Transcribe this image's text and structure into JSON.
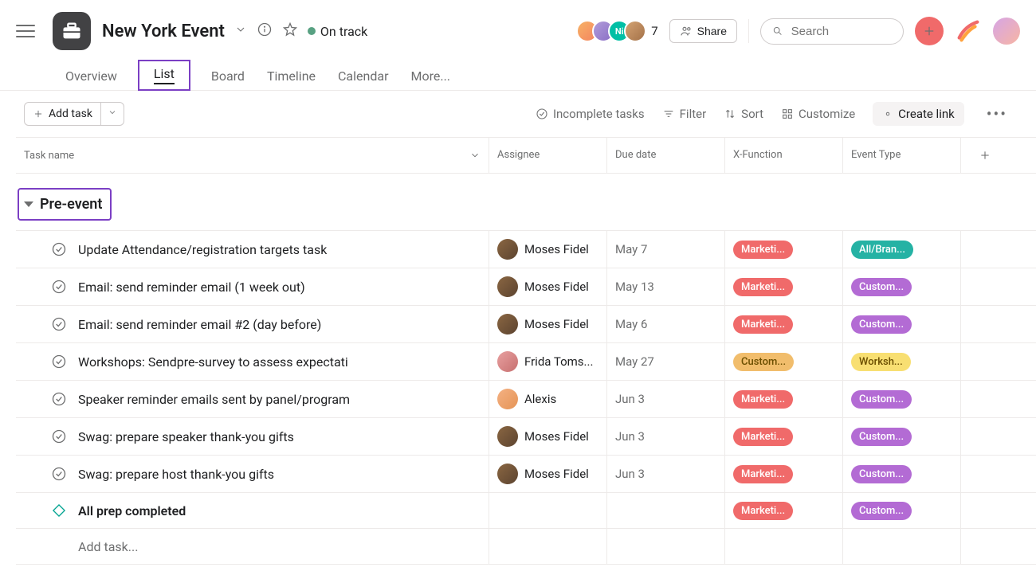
{
  "header": {
    "project_title": "New York Event",
    "status_label": "On track",
    "status_color": "#58a182",
    "member_initials": "Ni",
    "member_count": "7",
    "share_label": "Share",
    "search_placeholder": "Search"
  },
  "avatar_colors": [
    "linear-gradient(135deg,#f7b267,#f4845f)",
    "linear-gradient(135deg,#b19cd9,#8a6fc6)",
    "#00bfa5",
    "linear-gradient(135deg,#d4a373,#a47148)"
  ],
  "tabs": [
    {
      "label": "Overview"
    },
    {
      "label": "List",
      "active": true
    },
    {
      "label": "Board"
    },
    {
      "label": "Timeline"
    },
    {
      "label": "Calendar"
    },
    {
      "label": "More..."
    }
  ],
  "toolbar": {
    "add_task": "Add task",
    "incomplete": "Incomplete tasks",
    "filter": "Filter",
    "sort": "Sort",
    "customize": "Customize",
    "create_link": "Create link"
  },
  "columns": {
    "task": "Task name",
    "assignee": "Assignee",
    "due": "Due date",
    "xfn": "X-Function",
    "event": "Event Type"
  },
  "section": {
    "title": "Pre-event"
  },
  "pill_colors": {
    "marketing": "#f06a6a",
    "customer_yellow": "#f1bd6c",
    "all_brand": "#25b2a4",
    "customer_purple": "#b36bd4",
    "workshop": "#f8df72"
  },
  "tasks": [
    {
      "name": "Update Attendance/registration targets task",
      "assignee": {
        "name": "Moses Fidel",
        "color": "linear-gradient(135deg,#8a6642,#5c4430)"
      },
      "due": "May 7",
      "xfn": {
        "text": "Marketi...",
        "ckey": "marketing"
      },
      "event": {
        "text": "All/Bran...",
        "ckey": "all_brand"
      }
    },
    {
      "name": "Email: send reminder email (1 week out)",
      "assignee": {
        "name": "Moses Fidel",
        "color": "linear-gradient(135deg,#8a6642,#5c4430)"
      },
      "due": "May 13",
      "xfn": {
        "text": "Marketi...",
        "ckey": "marketing"
      },
      "event": {
        "text": "Custom...",
        "ckey": "customer_purple"
      }
    },
    {
      "name": "Email: send reminder email #2 (day before)",
      "assignee": {
        "name": "Moses Fidel",
        "color": "linear-gradient(135deg,#8a6642,#5c4430)"
      },
      "due": "May 6",
      "xfn": {
        "text": "Marketi...",
        "ckey": "marketing"
      },
      "event": {
        "text": "Custom...",
        "ckey": "customer_purple"
      }
    },
    {
      "name": "Workshops: Sendpre-survey to assess expectati",
      "assignee": {
        "name": "Frida Toms...",
        "color": "linear-gradient(135deg,#e8a0a0,#c77070)"
      },
      "due": "May 27",
      "xfn": {
        "text": "Custom...",
        "ckey": "customer_yellow"
      },
      "event": {
        "text": "Worksh...",
        "ckey": "workshop",
        "dark": true
      }
    },
    {
      "name": "Speaker reminder emails sent by panel/program",
      "assignee": {
        "name": "Alexis",
        "color": "linear-gradient(135deg,#f4b183,#e59456)"
      },
      "due": "Jun 3",
      "xfn": {
        "text": "Marketi...",
        "ckey": "marketing"
      },
      "event": {
        "text": "Custom...",
        "ckey": "customer_purple"
      }
    },
    {
      "name": "Swag: prepare speaker thank-you gifts",
      "assignee": {
        "name": "Moses Fidel",
        "color": "linear-gradient(135deg,#8a6642,#5c4430)"
      },
      "due": "Jun 3",
      "xfn": {
        "text": "Marketi...",
        "ckey": "marketing"
      },
      "event": {
        "text": "Custom...",
        "ckey": "customer_purple"
      }
    },
    {
      "name": "Swag: prepare host thank-you gifts",
      "assignee": {
        "name": "Moses Fidel",
        "color": "linear-gradient(135deg,#8a6642,#5c4430)"
      },
      "due": "Jun 3",
      "xfn": {
        "text": "Marketi...",
        "ckey": "marketing"
      },
      "event": {
        "text": "Custom...",
        "ckey": "customer_purple"
      }
    },
    {
      "name": "All prep completed",
      "milestone": true,
      "assignee": null,
      "due": "",
      "xfn": {
        "text": "Marketi...",
        "ckey": "marketing"
      },
      "event": {
        "text": "Custom...",
        "ckey": "customer_purple"
      }
    }
  ],
  "add_row_placeholder": "Add task..."
}
